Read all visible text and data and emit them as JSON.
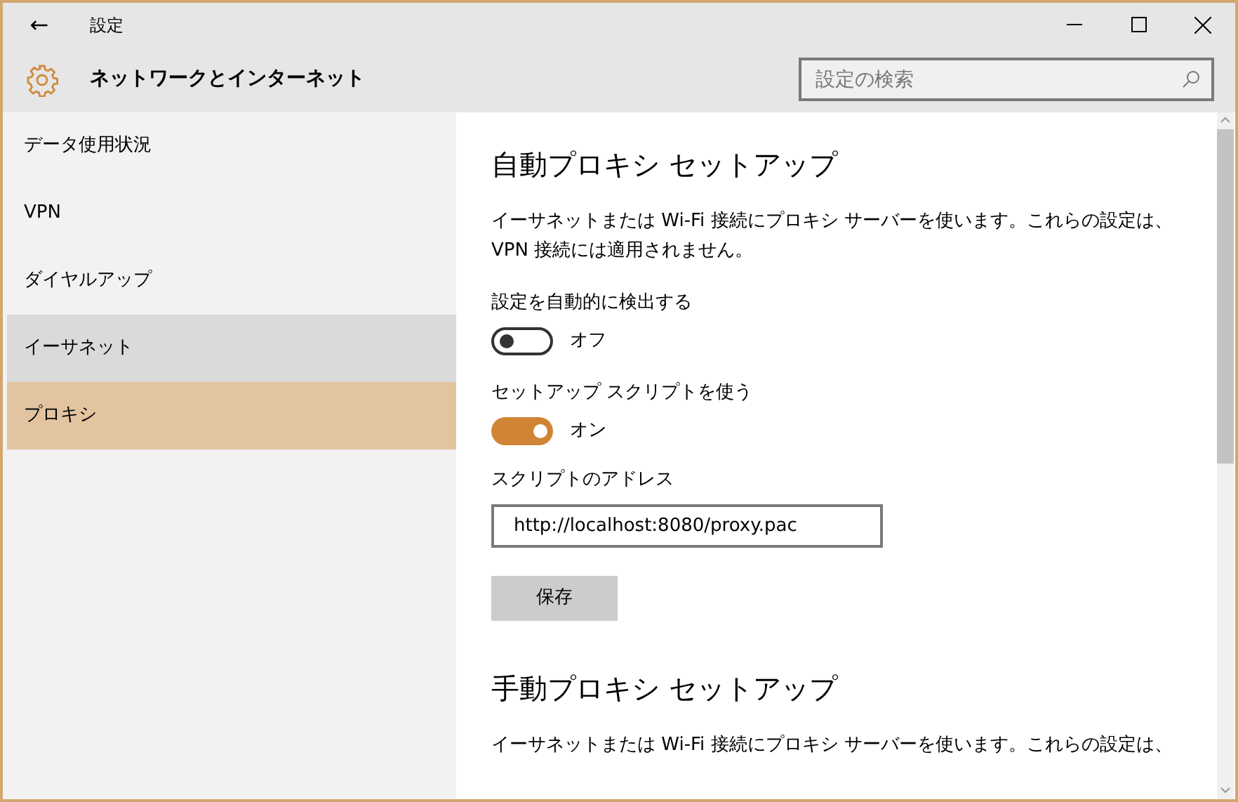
{
  "window": {
    "title": "設定",
    "back": "←"
  },
  "header": {
    "title": "ネットワークとインターネット",
    "search": {
      "placeholder": "設定の検索"
    }
  },
  "sidebar": {
    "items": [
      {
        "label": "データ使用状況",
        "selected": false,
        "hovered": false
      },
      {
        "label": "VPN",
        "selected": false,
        "hovered": false
      },
      {
        "label": "ダイヤルアップ",
        "selected": false,
        "hovered": false
      },
      {
        "label": "イーサネット",
        "selected": false,
        "hovered": true
      },
      {
        "label": "プロキシ",
        "selected": true,
        "hovered": false
      }
    ]
  },
  "content": [
    {
      "kind": "heading",
      "text": "自動プロキシ セットアップ"
    },
    {
      "kind": "paragraph",
      "lines": [
        "イーサネットまたは Wi-Fi 接続にプロキシ サーバーを使います。これらの設定は、",
        "VPN 接続には適用されません。"
      ]
    },
    {
      "kind": "toggle",
      "label": "設定を自動的に検出する",
      "on": false,
      "state_text": "オフ"
    },
    {
      "kind": "toggle",
      "label": "セットアップ スクリプトを使う",
      "on": true,
      "state_text": "オン"
    },
    {
      "kind": "field",
      "label": "スクリプトのアドレス",
      "value": "http://localhost:8080/proxy.pac"
    },
    {
      "kind": "button",
      "text": "保存"
    },
    {
      "kind": "heading",
      "text": "手動プロキシ セットアップ"
    },
    {
      "kind": "paragraph",
      "lines": [
        "イーサネットまたは Wi-Fi 接続にプロキシ サーバーを使います。これらの設定は、"
      ]
    }
  ]
}
